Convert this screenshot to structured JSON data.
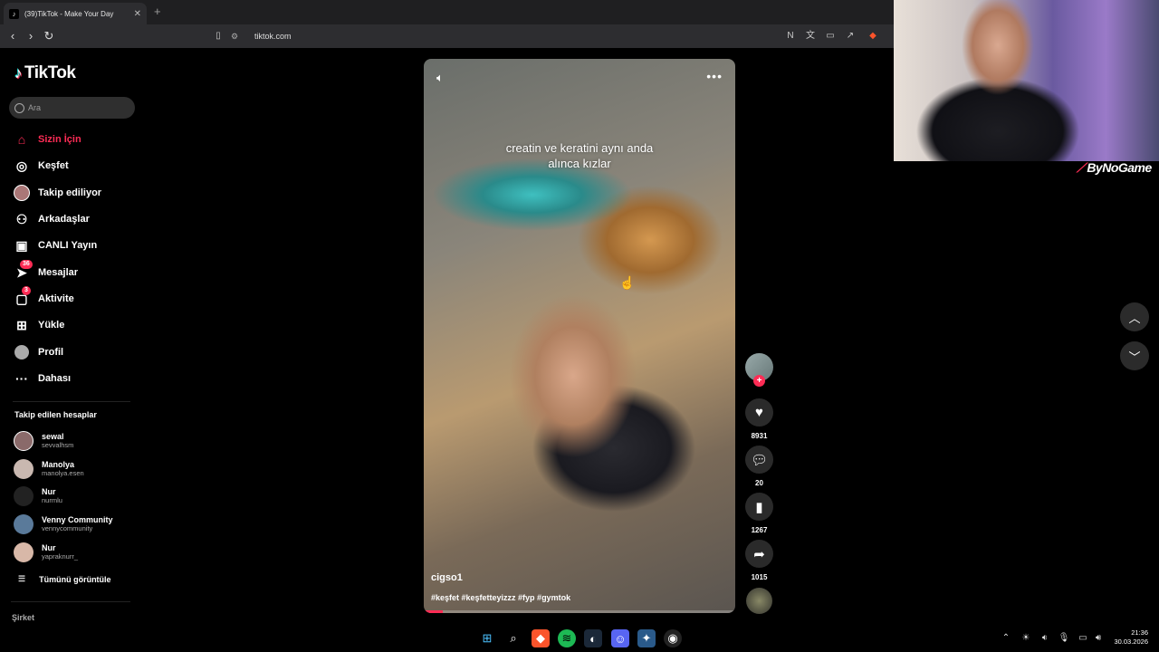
{
  "browser": {
    "tab_title": "(39)TikTok - Make Your Day",
    "tab_favicon": "tiktok-icon",
    "url": "tiktok.com",
    "new_tab_label": "+"
  },
  "sidebar": {
    "brand": "TikTok",
    "search_placeholder": "Ara",
    "nav": [
      {
        "label": "Sizin İçin",
        "icon": "home-icon",
        "active": true
      },
      {
        "label": "Keşfet",
        "icon": "compass-icon"
      },
      {
        "label": "Takip ediliyor",
        "icon": "following-avatar-icon"
      },
      {
        "label": "Arkadaşlar",
        "icon": "friends-icon"
      },
      {
        "label": "CANLI Yayın",
        "icon": "live-tv-icon"
      },
      {
        "label": "Mesajlar",
        "icon": "messages-icon",
        "badge": "36"
      },
      {
        "label": "Aktivite",
        "icon": "activity-icon",
        "badge": "3"
      },
      {
        "label": "Yükle",
        "icon": "upload-icon"
      },
      {
        "label": "Profil",
        "icon": "profile-icon"
      },
      {
        "label": "Dahası",
        "icon": "more-icon"
      }
    ],
    "following_heading": "Takip edilen hesaplar",
    "following": [
      {
        "name": "sewal",
        "username": "sevvalhsm"
      },
      {
        "name": "Manolya",
        "username": "manolya.esen"
      },
      {
        "name": "Nur",
        "username": "nurmlu"
      },
      {
        "name": "Venny Community",
        "username": "vennycommunity"
      },
      {
        "name": "Nur",
        "username": "yapraknurr_"
      }
    ],
    "see_all": "Tümünü görüntüle",
    "company": "Şirket"
  },
  "video": {
    "caption": "creatin ve keratini aynı anda\nalınca kızlar",
    "author": "cigso1",
    "hashtags": "#keşfet #keşfetteyizzz #fyp #gymtok",
    "progress": 0.06
  },
  "actions": {
    "likes": "8931",
    "comments": "20",
    "saves": "1267",
    "shares": "1015"
  },
  "stream": {
    "brand": "ByNoGame"
  },
  "taskbar": {
    "time": "21:36",
    "date": "30.03.2026"
  },
  "colors": {
    "accent": "#fe2c55",
    "background": "#000000"
  }
}
